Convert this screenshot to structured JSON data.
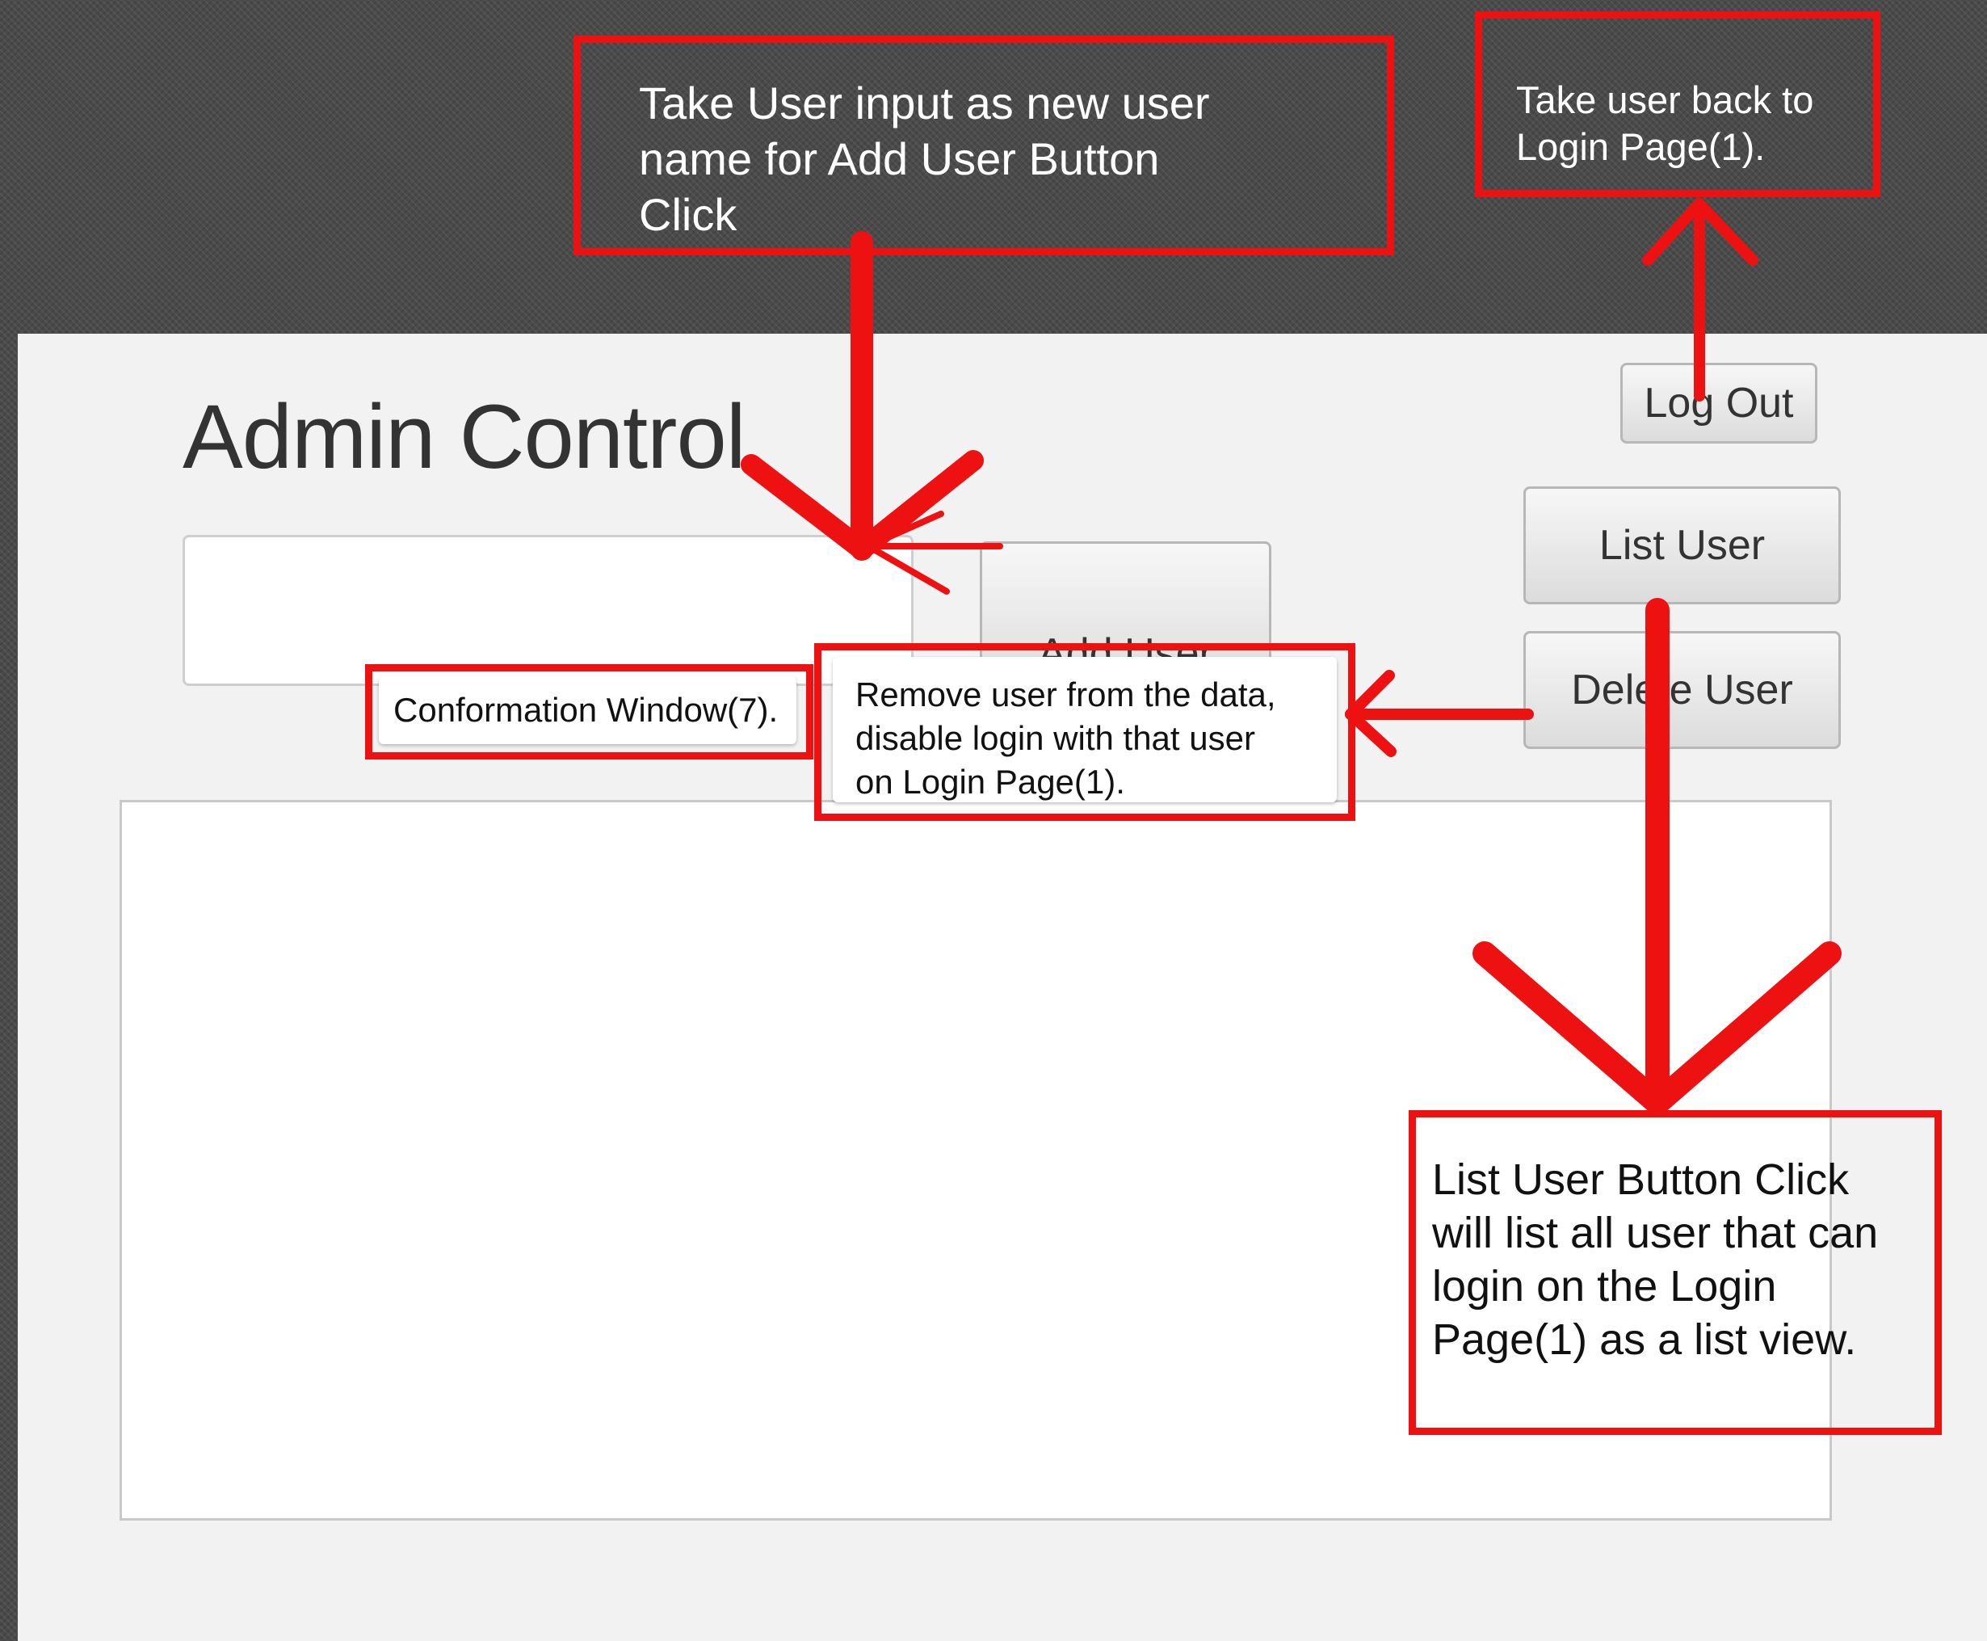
{
  "app": {
    "title": "Admin Control",
    "buttons": {
      "logout": "Log Out",
      "list_user": "List User",
      "delete_user": "Delete User",
      "add_user": "Add User"
    },
    "username_input": {
      "value": "",
      "placeholder": ""
    },
    "user_list": {
      "items": []
    }
  },
  "annotations": {
    "input_note": "Take User input  as new user\nname for Add User Button\nClick",
    "logout_note": "Take user back to\nLogin Page(1).",
    "confirm_note": "Conformation Window(7).",
    "delete_note": "Remove user from the data,\ndisable login with that user\non Login Page(1).",
    "list_note": "List User Button Click\nwill list all user that can\nlogin on the Login\nPage(1) as a list view."
  },
  "colors": {
    "annotation_red": "#ee1111",
    "window_bg": "#f2f2f2",
    "backdrop": "#4a4a4a"
  }
}
